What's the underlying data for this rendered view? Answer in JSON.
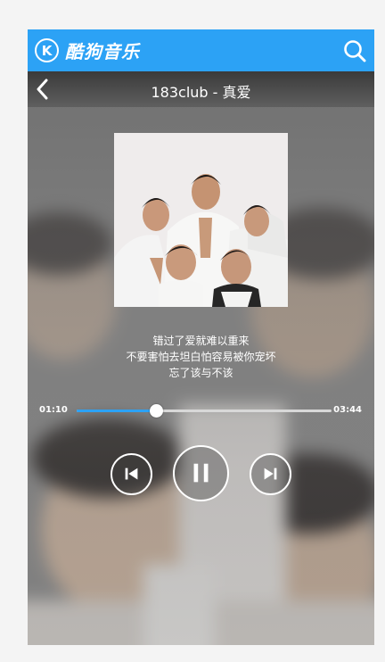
{
  "app": {
    "name": "酷狗音乐",
    "logo_letter": "K",
    "brand_color": "#2ca2f5"
  },
  "player": {
    "song_title": "183club - 真爱",
    "lyrics": [
      "错过了爱就难以重来",
      "不要害怕去坦白怕容易被你宠坏",
      "忘了该与不该"
    ],
    "current_time": "01:10",
    "total_time": "03:44",
    "progress_fraction": 0.3125,
    "state": "playing"
  },
  "icons": {
    "search": "search-icon",
    "back": "chevron-left-icon",
    "prev": "skip-previous-icon",
    "pause": "pause-icon",
    "next": "skip-next-icon"
  }
}
